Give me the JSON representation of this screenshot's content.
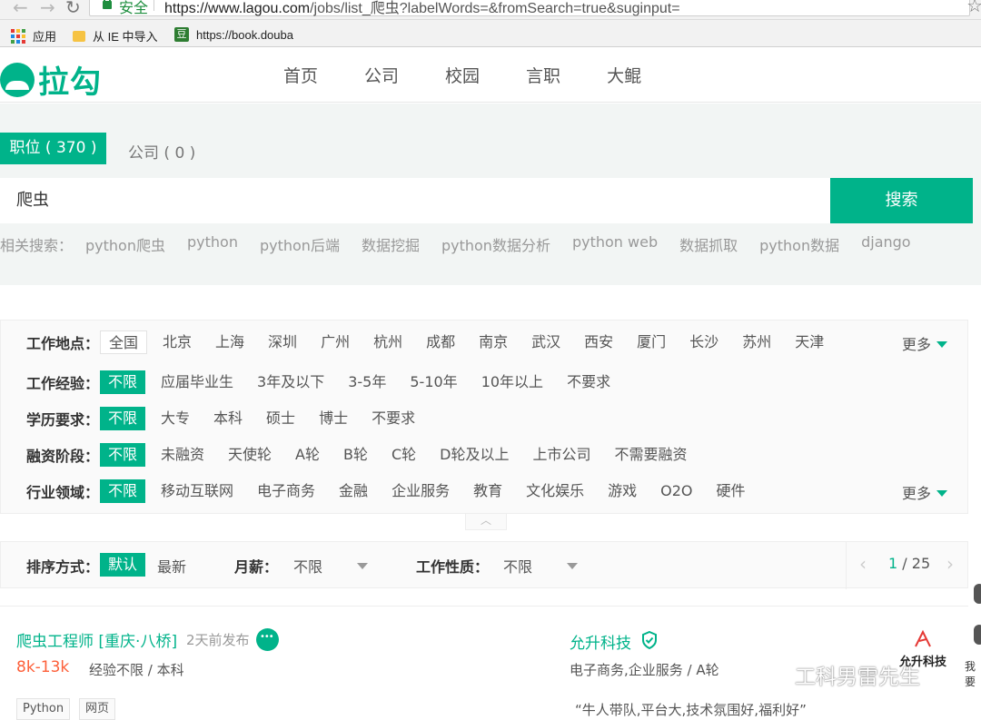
{
  "browser": {
    "secure_label": "安全",
    "url_host": "https://www.lagou.com",
    "url_path": "/jobs/list_爬虫?labelWords=&fromSearch=true&suginput=",
    "bookmarks": {
      "apps": "应用",
      "ie_import": "从 IE 中导入",
      "douban": "https://book.douba"
    }
  },
  "site": {
    "logo_text": "拉勾",
    "nav": [
      "首页",
      "公司",
      "校园",
      "言职",
      "大鲲"
    ]
  },
  "search": {
    "tab_positions": "职位 ( 370 )",
    "tab_companies": "公司 ( 0 )",
    "query": "爬虫",
    "button": "搜索",
    "related_label": "相关搜索：",
    "related": [
      "python爬虫",
      "python",
      "python后端",
      "数据挖掘",
      "python数据分析",
      "python web",
      "数据抓取",
      "python数据",
      "django"
    ]
  },
  "filters": {
    "more_label": "更多",
    "rows": [
      {
        "label": "工作地点：",
        "options": [
          "全国",
          "北京",
          "上海",
          "深圳",
          "广州",
          "杭州",
          "成都",
          "南京",
          "武汉",
          "西安",
          "厦门",
          "长沙",
          "苏州",
          "天津"
        ]
      },
      {
        "label": "工作经验：",
        "options": [
          "不限",
          "应届毕业生",
          "3年及以下",
          "3-5年",
          "5-10年",
          "10年以上",
          "不要求"
        ]
      },
      {
        "label": "学历要求：",
        "options": [
          "不限",
          "大专",
          "本科",
          "硕士",
          "博士",
          "不要求"
        ]
      },
      {
        "label": "融资阶段：",
        "options": [
          "不限",
          "未融资",
          "天使轮",
          "A轮",
          "B轮",
          "C轮",
          "D轮及以上",
          "上市公司",
          "不需要融资"
        ]
      },
      {
        "label": "行业领域：",
        "options": [
          "不限",
          "移动互联网",
          "电子商务",
          "金融",
          "企业服务",
          "教育",
          "文化娱乐",
          "游戏",
          "O2O",
          "硬件"
        ]
      }
    ]
  },
  "sortbar": {
    "sort_label": "排序方式：",
    "sort_default": "默认",
    "sort_new": "最新",
    "salary_label": "月薪：",
    "salary_value": "不限",
    "nature_label": "工作性质：",
    "nature_value": "不限",
    "page_current": "1",
    "page_total": "/ 25"
  },
  "job": {
    "title": "爬虫工程师 [重庆·八桥]",
    "posted": "2天前发布",
    "salary": "8k-13k",
    "requirements": "经验不限 / 本科",
    "tags": [
      "Python",
      "网页"
    ],
    "company": "允升科技",
    "industry": "电子商务,企业服务 / A轮",
    "slogan": "“牛人带队,平台大,技术氛围好,福利好”",
    "company_logo_text": "允升科技"
  },
  "overlay": {
    "watermark": "工科男雷先生",
    "side_text": "我要"
  },
  "colors": {
    "brand": "#00b38a",
    "salary": "#fd5f39"
  }
}
